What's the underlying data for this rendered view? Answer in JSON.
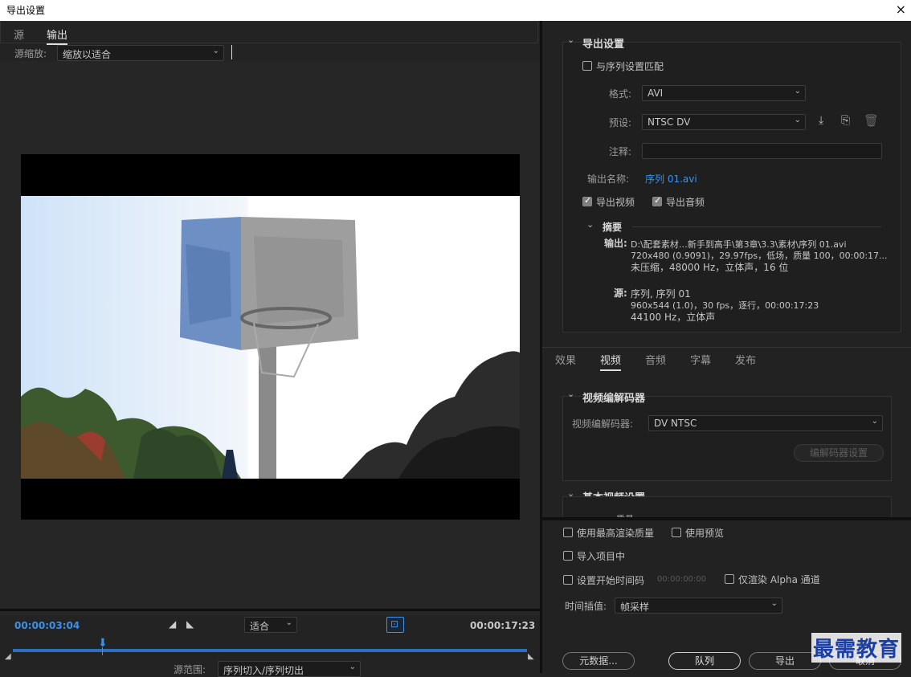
{
  "window": {
    "title": "导出设置",
    "close": "×"
  },
  "left": {
    "tabs": [
      {
        "label": "源"
      },
      {
        "label": "输出"
      }
    ],
    "source_scale_label": "源缩放:",
    "source_scale_value": "缩放以适合",
    "timeline": {
      "current_time": "00:00:03:04",
      "fit_value": "适合",
      "end_time": "00:00:17:23",
      "source_range_label": "源范围:",
      "source_range_value": "序列切入/序列切出"
    }
  },
  "export_settings": {
    "header": "导出设置",
    "match_sequence": "与序列设置匹配",
    "format_label": "格式:",
    "format_value": "AVI",
    "preset_label": "预设:",
    "preset_value": "NTSC DV",
    "comments_label": "注释:",
    "output_name_label": "输出名称:",
    "output_name_value": "序列 01.avi",
    "export_video": "导出视频",
    "export_audio": "导出音频",
    "summary": {
      "header": "摘要",
      "output_label": "输出:",
      "output_lines": [
        "D:\\配套素材…新手到高手\\第3章\\3.3\\素材\\序列 01.avi",
        "720x480 (0.9091)，29.97fps，低场，质量 100，00:00:17...",
        "未压缩，48000 Hz，立体声，16 位"
      ],
      "source_label": "源:",
      "source_lines": [
        "序列, 序列 01",
        "960x544 (1.0)，30 fps，逐行，00:00:17:23",
        "44100 Hz，立体声"
      ]
    }
  },
  "settings_tabs": [
    {
      "label": "效果"
    },
    {
      "label": "视频"
    },
    {
      "label": "音频"
    },
    {
      "label": "字幕"
    },
    {
      "label": "发布"
    }
  ],
  "video_codec": {
    "header": "视频编解码器",
    "codec_label": "视频编解码器:",
    "codec_value": "DV NTSC",
    "codec_settings_button": "编解码器设置"
  },
  "basic_video": {
    "header": "基本视频设置",
    "partial_label": "质量"
  },
  "bottom": {
    "max_render_quality": "使用最高渲染质量",
    "use_previews": "使用预览",
    "import_into_project": "导入项目中",
    "set_start_timecode": "设置开始时间码",
    "start_timecode_value": "00:00:00:00",
    "render_alpha_only": "仅渲染 Alpha 通道",
    "time_interpolation_label": "时间插值:",
    "time_interpolation_value": "帧采样",
    "metadata_button": "元数据...",
    "queue_button": "队列",
    "export_button": "导出",
    "cancel_button": "取消"
  },
  "watermark": "最需教育",
  "colors": {
    "accent": "#3a92e8",
    "background": "#232323",
    "watermark": "#1a3fa8"
  }
}
